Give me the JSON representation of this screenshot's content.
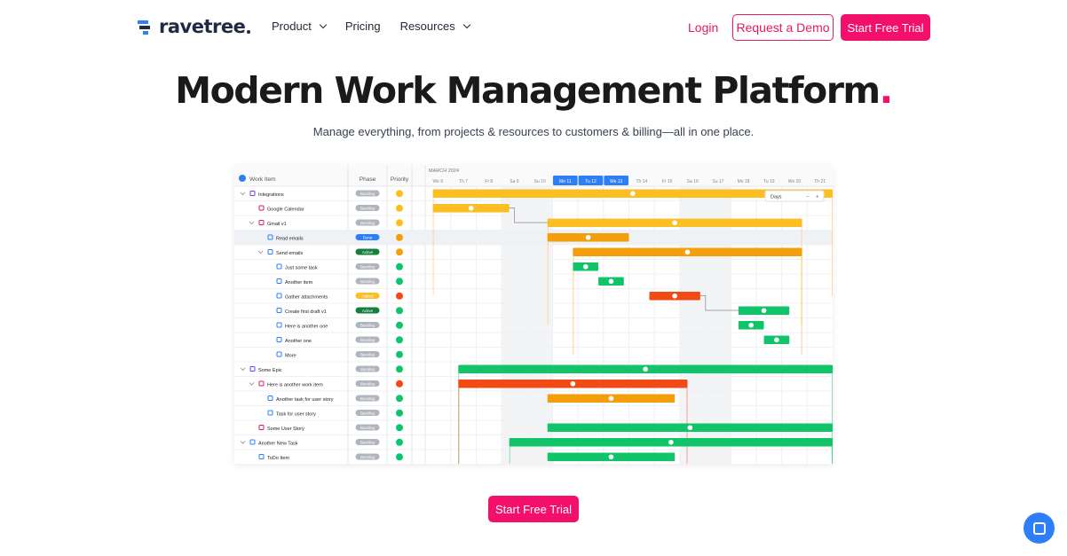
{
  "header": {
    "logo_text": "ravetree",
    "nav": [
      {
        "label": "Product",
        "has_dropdown": true
      },
      {
        "label": "Pricing",
        "has_dropdown": false
      },
      {
        "label": "Resources",
        "has_dropdown": true
      }
    ],
    "login": "Login",
    "demo_button": "Request a Demo",
    "trial_button": "Start Free Trial"
  },
  "hero": {
    "title": "Modern Work Management Platform",
    "title_dot": ".",
    "subtitle": "Manage everything, from projects & resources to customers & billing—all in one place."
  },
  "gantt": {
    "columns": {
      "work_item": "Work Item",
      "phase": "Phase",
      "priority": "Priority"
    },
    "month": "MARCH 2024",
    "days": [
      "We 6",
      "Th 7",
      "Fr 8",
      "Sa 9",
      "Su 10",
      "Mo 11",
      "Tu 12",
      "We 13",
      "Th 14",
      "Fr 15",
      "Sa 16",
      "Su 17",
      "Mo 18",
      "Tu 19",
      "We 20",
      "Th 21"
    ],
    "highlight_days": [
      5,
      6,
      7
    ],
    "zoom": "Days",
    "rows": [
      {
        "label": "Integrations",
        "indent": 0,
        "phase": "Backlog",
        "prio": "yellow",
        "icon": "epic"
      },
      {
        "label": "Google Calendar",
        "indent": 1,
        "phase": "Backlog",
        "prio": "yellow",
        "icon": "story"
      },
      {
        "label": "Gmail v1",
        "indent": 1,
        "phase": "Backlog",
        "prio": "yellow",
        "icon": "story"
      },
      {
        "label": "Read emails",
        "indent": 2,
        "phase": "Done",
        "prio": "orange",
        "icon": "task"
      },
      {
        "label": "Send emails",
        "indent": 2,
        "phase": "Active",
        "prio": "orange",
        "icon": "task"
      },
      {
        "label": "Just some task",
        "indent": 3,
        "phase": "Backlog",
        "prio": "green",
        "icon": "task"
      },
      {
        "label": "Another item",
        "indent": 3,
        "phase": "Backlog",
        "prio": "green",
        "icon": "task"
      },
      {
        "label": "Gather attachments",
        "indent": 3,
        "phase": "Halted",
        "prio": "red",
        "icon": "sub"
      },
      {
        "label": "Create first draft v1",
        "indent": 3,
        "phase": "Active",
        "prio": "green",
        "icon": "sub"
      },
      {
        "label": "Here is another one",
        "indent": 3,
        "phase": "Backlog",
        "prio": "green",
        "icon": "task"
      },
      {
        "label": "Another one",
        "indent": 3,
        "phase": "Backlog",
        "prio": "green",
        "icon": "task"
      },
      {
        "label": "More",
        "indent": 3,
        "phase": "Backlog",
        "prio": "green",
        "icon": "task"
      },
      {
        "label": "Some Epic",
        "indent": 0,
        "phase": "Backlog",
        "prio": "green",
        "icon": "epic"
      },
      {
        "label": "Here is another work item",
        "indent": 1,
        "phase": "Backlog",
        "prio": "red",
        "icon": "story"
      },
      {
        "label": "Another task for user story",
        "indent": 2,
        "phase": "Backlog",
        "prio": "green",
        "icon": "task"
      },
      {
        "label": "Task for user story",
        "indent": 2,
        "phase": "Backlog",
        "prio": "green",
        "icon": "task"
      },
      {
        "label": "Some User Story",
        "indent": 1,
        "phase": "Backlog",
        "prio": "green",
        "icon": "story"
      },
      {
        "label": "Another New Task",
        "indent": 0,
        "phase": "Backlog",
        "prio": "green",
        "icon": "task"
      },
      {
        "label": "ToDo Item",
        "indent": 1,
        "phase": "Backlog",
        "prio": "green",
        "icon": "sub"
      }
    ],
    "bars": [
      {
        "row": 0,
        "start": 0.3,
        "end": 16,
        "color": "yellow",
        "summary": true
      },
      {
        "row": 1,
        "start": 0.3,
        "end": 3.3,
        "color": "yellow"
      },
      {
        "row": 2,
        "start": 4.8,
        "end": 14.8,
        "color": "yellow",
        "summary": true
      },
      {
        "row": 3,
        "start": 4.8,
        "end": 8.0,
        "color": "orange"
      },
      {
        "row": 4,
        "start": 5.8,
        "end": 14.8,
        "color": "orange",
        "summary": true
      },
      {
        "row": 5,
        "start": 5.8,
        "end": 6.8,
        "color": "green"
      },
      {
        "row": 6,
        "start": 6.8,
        "end": 7.8,
        "color": "green"
      },
      {
        "row": 7,
        "start": 8.8,
        "end": 10.8,
        "color": "red"
      },
      {
        "row": 8,
        "start": 12.3,
        "end": 14.3,
        "color": "green"
      },
      {
        "row": 9,
        "start": 12.3,
        "end": 13.3,
        "color": "green"
      },
      {
        "row": 10,
        "start": 13.3,
        "end": 14.3,
        "color": "green"
      },
      {
        "row": 12,
        "start": 1.3,
        "end": 16,
        "color": "green",
        "summary": true
      },
      {
        "row": 13,
        "start": 1.3,
        "end": 10.3,
        "color": "red",
        "summary": true
      },
      {
        "row": 14,
        "start": 4.8,
        "end": 9.8,
        "color": "orange"
      },
      {
        "row": 16,
        "start": 4.8,
        "end": 16,
        "color": "green"
      },
      {
        "row": 17,
        "start": 3.3,
        "end": 16,
        "color": "green",
        "summary": true
      },
      {
        "row": 18,
        "start": 4.8,
        "end": 9.8,
        "color": "green"
      }
    ]
  },
  "cta": "Start Free Trial",
  "colors": {
    "accent": "#f2106a",
    "yellow": "#fbbf24",
    "orange": "#f59e0b",
    "green": "#10c46a",
    "red": "#f24a14",
    "chat": "#2d7ff9"
  }
}
